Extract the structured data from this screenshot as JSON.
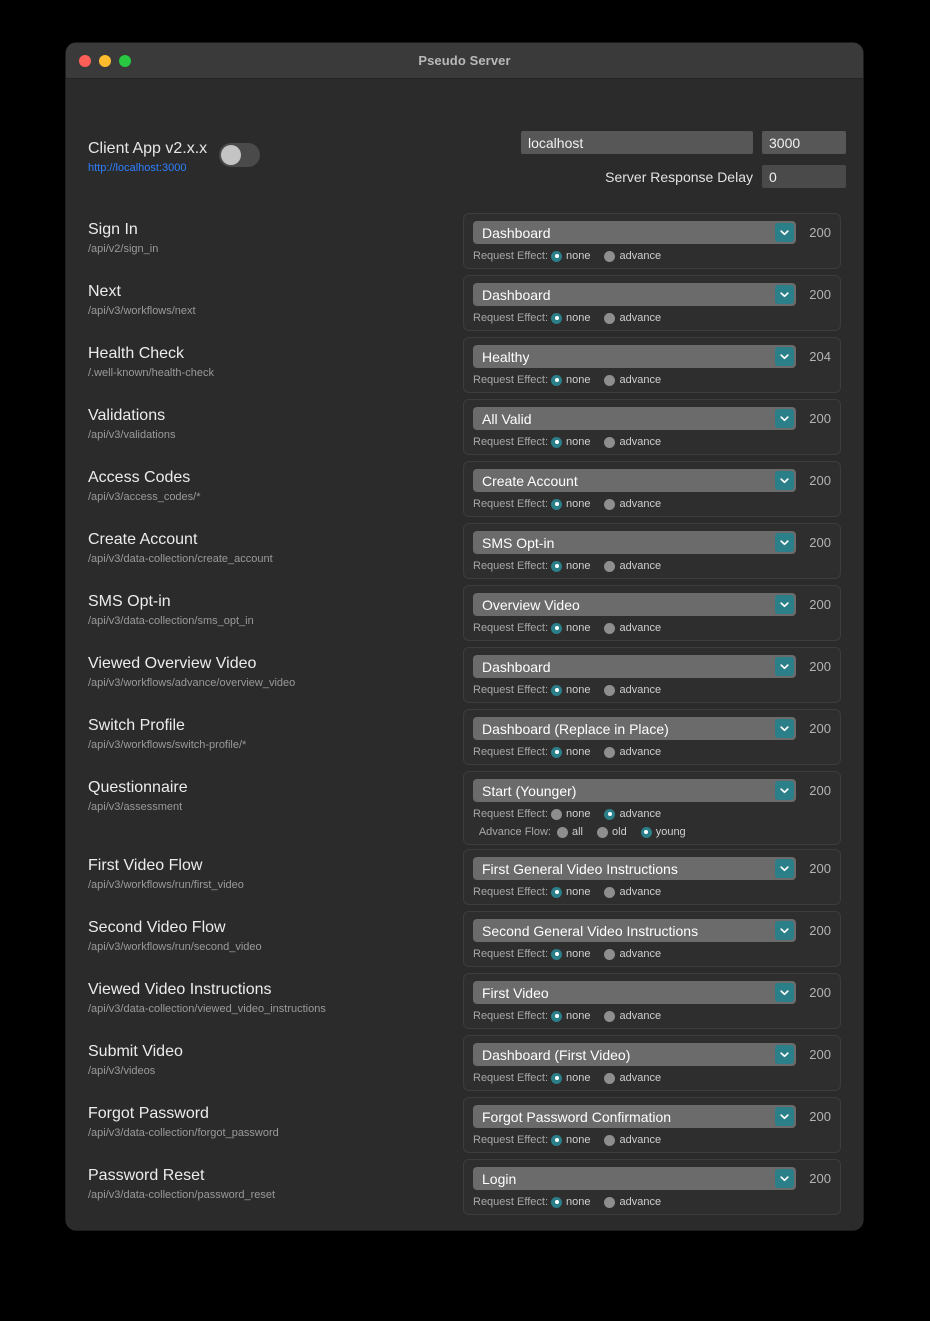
{
  "window": {
    "title": "Pseudo Server",
    "traffic_lights": [
      "close",
      "minimize",
      "maximize"
    ]
  },
  "client": {
    "name": "Client App v2.x.x",
    "url": "http://localhost:3000",
    "toggle_on": false
  },
  "connection": {
    "host": "localhost",
    "port": "3000",
    "delay_label": "Server Response Delay",
    "delay_value": "0"
  },
  "labels": {
    "request_effect": "Request Effect:",
    "advance_flow": "Advance Flow:",
    "effect_none": "none",
    "effect_advance": "advance",
    "flow_all": "all",
    "flow_old": "old",
    "flow_young": "young"
  },
  "colors": {
    "accent": "#2a7f89",
    "link": "#2e7fff",
    "window_bg": "#2b2b2b",
    "titlebar_bg": "#3a3a3a",
    "select_bg": "#6b6b6b"
  },
  "endpoints": [
    {
      "name": "Sign In",
      "path": "/api/v2/sign_in",
      "response": "Dashboard",
      "status": "200",
      "effect": "none",
      "flow": null
    },
    {
      "name": "Next",
      "path": "/api/v3/workflows/next",
      "response": "Dashboard",
      "status": "200",
      "effect": "none",
      "flow": null
    },
    {
      "name": "Health Check",
      "path": "/.well-known/health-check",
      "response": "Healthy",
      "status": "204",
      "effect": "none",
      "flow": null
    },
    {
      "name": "Validations",
      "path": "/api/v3/validations",
      "response": "All Valid",
      "status": "200",
      "effect": "none",
      "flow": null
    },
    {
      "name": "Access Codes",
      "path": "/api/v3/access_codes/*",
      "response": "Create Account",
      "status": "200",
      "effect": "none",
      "flow": null
    },
    {
      "name": "Create Account",
      "path": "/api/v3/data-collection/create_account",
      "response": "SMS Opt-in",
      "status": "200",
      "effect": "none",
      "flow": null
    },
    {
      "name": "SMS Opt-in",
      "path": "/api/v3/data-collection/sms_opt_in",
      "response": "Overview Video",
      "status": "200",
      "effect": "none",
      "flow": null
    },
    {
      "name": "Viewed Overview Video",
      "path": "/api/v3/workflows/advance/overview_video",
      "response": "Dashboard",
      "status": "200",
      "effect": "none",
      "flow": null
    },
    {
      "name": "Switch Profile",
      "path": "/api/v3/workflows/switch-profile/*",
      "response": "Dashboard (Replace in Place)",
      "status": "200",
      "effect": "none",
      "flow": null
    },
    {
      "name": "Questionnaire",
      "path": "/api/v3/assessment",
      "response": "Start (Younger)",
      "status": "200",
      "effect": "advance",
      "flow": "young"
    },
    {
      "name": "First Video Flow",
      "path": "/api/v3/workflows/run/first_video",
      "response": "First General Video Instructions",
      "status": "200",
      "effect": "none",
      "flow": null
    },
    {
      "name": "Second Video Flow",
      "path": "/api/v3/workflows/run/second_video",
      "response": "Second General Video Instructions",
      "status": "200",
      "effect": "none",
      "flow": null
    },
    {
      "name": "Viewed Video Instructions",
      "path": "/api/v3/data-collection/viewed_video_instructions",
      "response": "First Video",
      "status": "200",
      "effect": "none",
      "flow": null
    },
    {
      "name": "Submit Video",
      "path": "/api/v3/videos",
      "response": "Dashboard (First Video)",
      "status": "200",
      "effect": "none",
      "flow": null
    },
    {
      "name": "Forgot Password",
      "path": "/api/v3/data-collection/forgot_password",
      "response": "Forgot Password Confirmation",
      "status": "200",
      "effect": "none",
      "flow": null
    },
    {
      "name": "Password Reset",
      "path": "/api/v3/data-collection/password_reset",
      "response": "Login",
      "status": "200",
      "effect": "none",
      "flow": null
    }
  ]
}
